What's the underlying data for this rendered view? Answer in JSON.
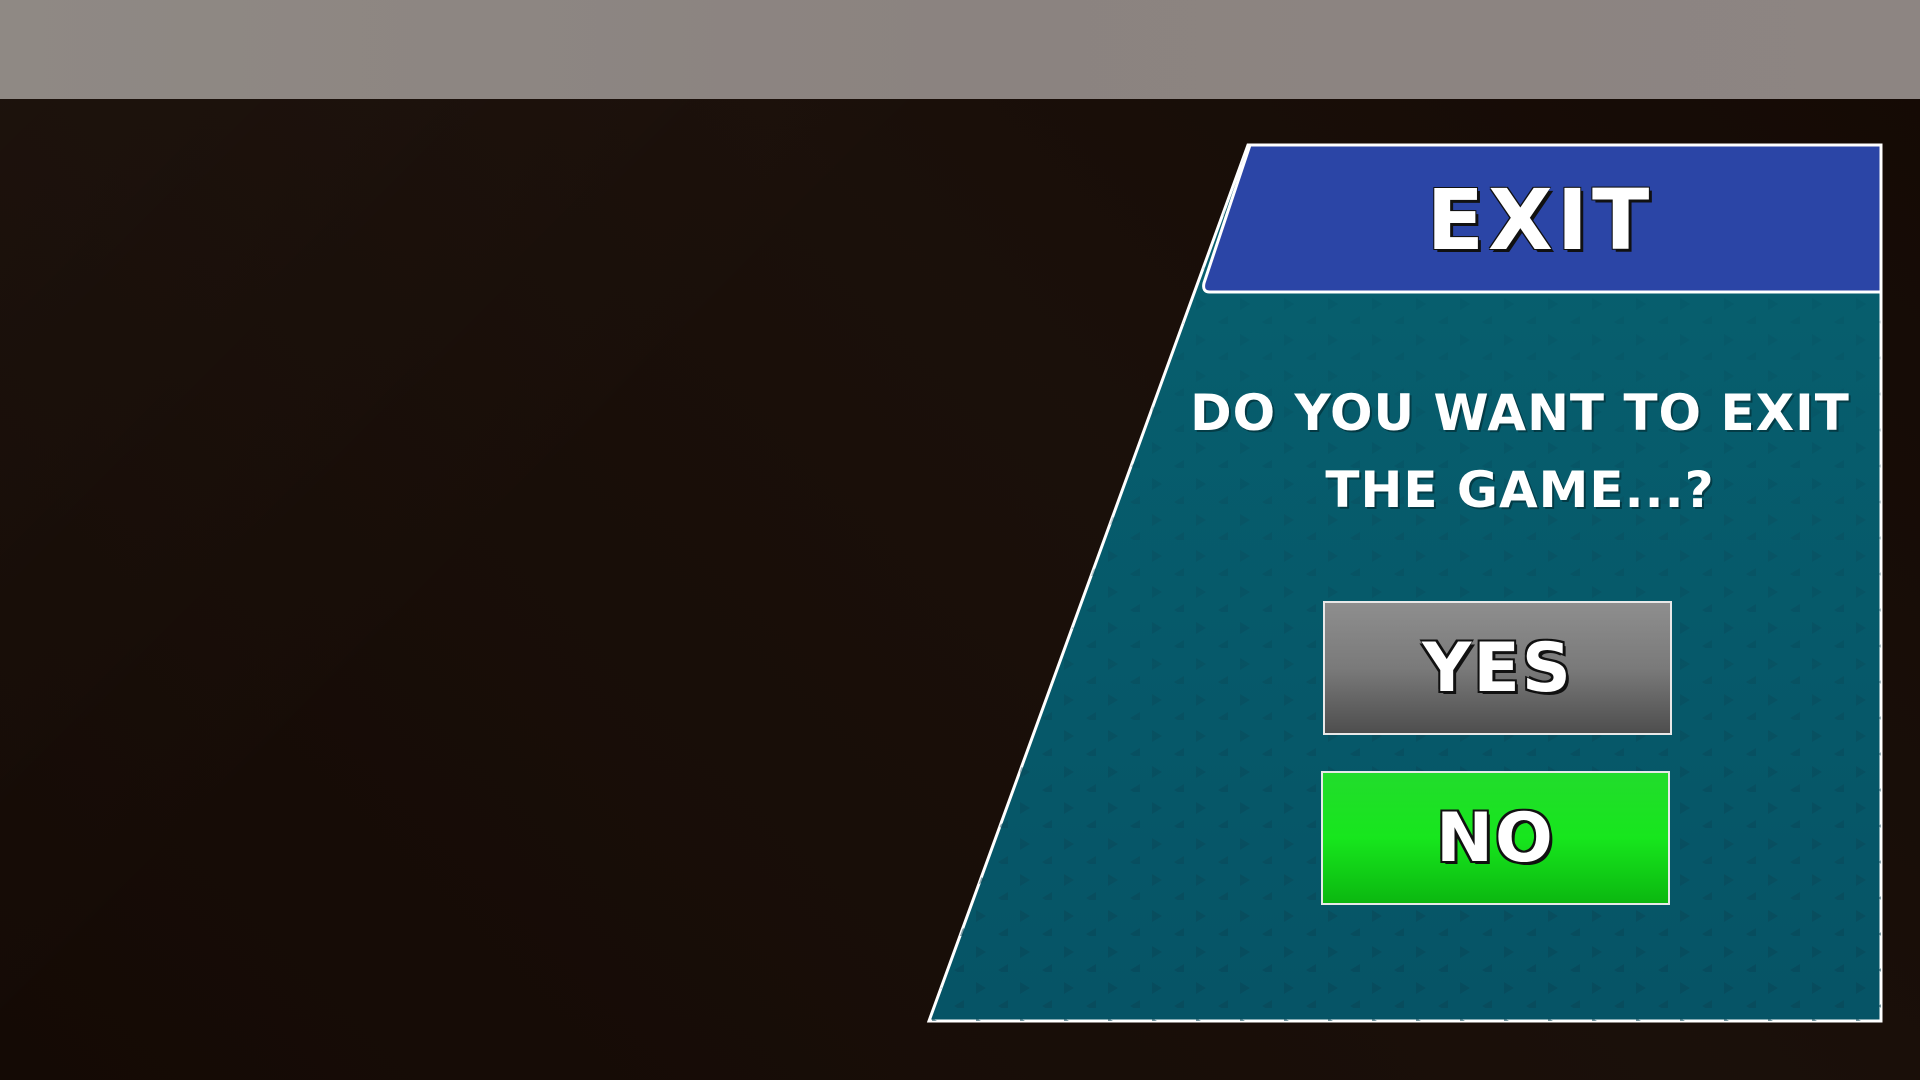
{
  "dialog": {
    "title": "EXIT",
    "message_line1": "DO YOU WANT TO EXIT",
    "message_line2": "THE GAME...?",
    "yes_label": "YES",
    "no_label": "NO"
  },
  "colors": {
    "header": "#2b45a6",
    "panel": "#08606f",
    "yes_button": "#7a7a7a",
    "no_button": "#17e61d",
    "background": "#160b05",
    "top_bar": "#8d8582"
  }
}
